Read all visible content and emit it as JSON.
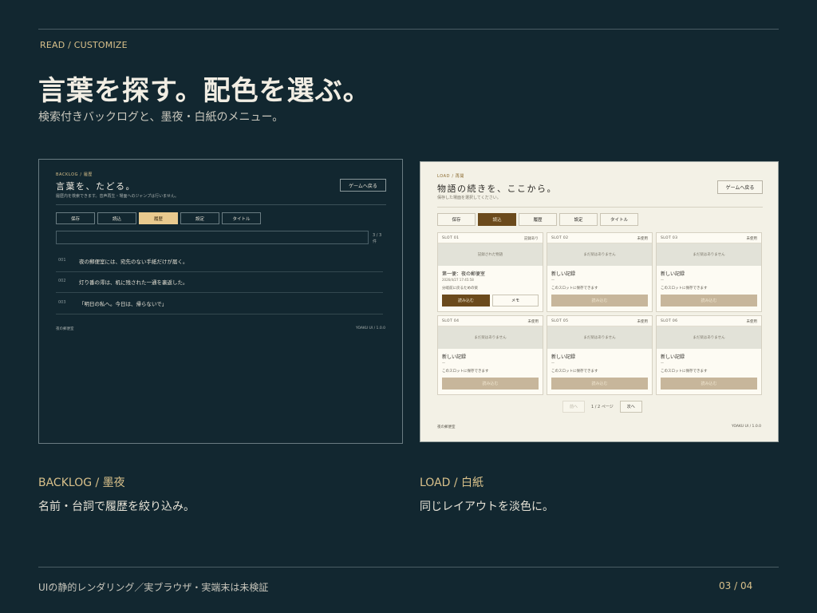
{
  "eyebrow": "READ / CUSTOMIZE",
  "headline": "言葉を探す。配色を選ぶ。",
  "subhead": "検索付きバックログと、墨夜・白紙のメニュー。",
  "backlog": {
    "eyebrow": "BACKLOG / 履歴",
    "title": "言葉を、たどる。",
    "desc": "履歴内を検索できます。音声再生・場面へのジャンプは行いません。",
    "back_button": "ゲームへ戻る",
    "tabs": [
      {
        "label": "保存"
      },
      {
        "label": "読込"
      },
      {
        "label": "履歴"
      },
      {
        "label": "設定"
      },
      {
        "label": "タイトル"
      }
    ],
    "active_tab": "履歴",
    "count": "3 / 3 件",
    "rows": [
      {
        "num": "001",
        "text": "夜の郵便室には、宛先のない手紙だけが届く。"
      },
      {
        "num": "002",
        "text": "灯り番の澪は、机に残された一通を裏返した。"
      },
      {
        "num": "003",
        "text": "「明日の私へ。今日は、帰らないで」"
      }
    ],
    "footer_left": "夜の郵便室",
    "footer_right": "YOAKU UI / 1.0.0"
  },
  "load": {
    "eyebrow": "LOAD / 再開",
    "title": "物語の続きを、ここから。",
    "desc": "保存した場面を選択してください。",
    "back_button": "ゲームへ戻る",
    "tabs": [
      {
        "label": "保存"
      },
      {
        "label": "読込"
      },
      {
        "label": "履歴"
      },
      {
        "label": "設定"
      },
      {
        "label": "タイトル"
      }
    ],
    "active_tab": "読込",
    "slots": [
      {
        "id": "SLOT 01",
        "status": "記録あり",
        "thumb": "記録された物語",
        "name": "第一便：夜の郵便室",
        "date": "2026/4/27 17:45:58",
        "note": "分岐前に戻るための栞",
        "load": "読み込む",
        "memo": "メモ",
        "filled": true
      },
      {
        "id": "SLOT 02",
        "status": "未使用",
        "thumb": "まだ栞はありません",
        "name": "新しい記録",
        "date": "—",
        "note": "このスロットに保存できます",
        "load": "読み込む",
        "filled": false
      },
      {
        "id": "SLOT 03",
        "status": "未使用",
        "thumb": "まだ栞はありません",
        "name": "新しい記録",
        "date": "—",
        "note": "このスロットに保存できます",
        "load": "読み込む",
        "filled": false
      },
      {
        "id": "SLOT 04",
        "status": "未使用",
        "thumb": "まだ栞はありません",
        "name": "新しい記録",
        "date": "—",
        "note": "このスロットに保存できます",
        "load": "読み込む",
        "filled": false
      },
      {
        "id": "SLOT 05",
        "status": "未使用",
        "thumb": "まだ栞はありません",
        "name": "新しい記録",
        "date": "—",
        "note": "このスロットに保存できます",
        "load": "読み込む",
        "filled": false
      },
      {
        "id": "SLOT 06",
        "status": "未使用",
        "thumb": "まだ栞はありません",
        "name": "新しい記録",
        "date": "—",
        "note": "このスロットに保存できます",
        "load": "読み込む",
        "filled": false
      }
    ],
    "pager": {
      "prev": "前へ",
      "page": "1 / 2 ページ",
      "next": "次へ"
    },
    "footer_left": "夜の郵便室",
    "footer_right": "YOAKU UI / 1.0.0"
  },
  "captions": {
    "left_title": "BACKLOG / 墨夜",
    "left_desc": "名前・台詞で履歴を絞り込み。",
    "right_title": "LOAD / 白紙",
    "right_desc": "同じレイアウトを淡色に。"
  },
  "footer": {
    "note": "UIの静的レンダリング／実ブラウザ・実端末は未検証",
    "page": "03 / 04"
  },
  "colors": {
    "background": "#122730",
    "accent": "#d8c08a",
    "dark_active_tab": "#e8c98e",
    "light_active": "#6b4a1c",
    "paper": "#f3f1e6"
  }
}
